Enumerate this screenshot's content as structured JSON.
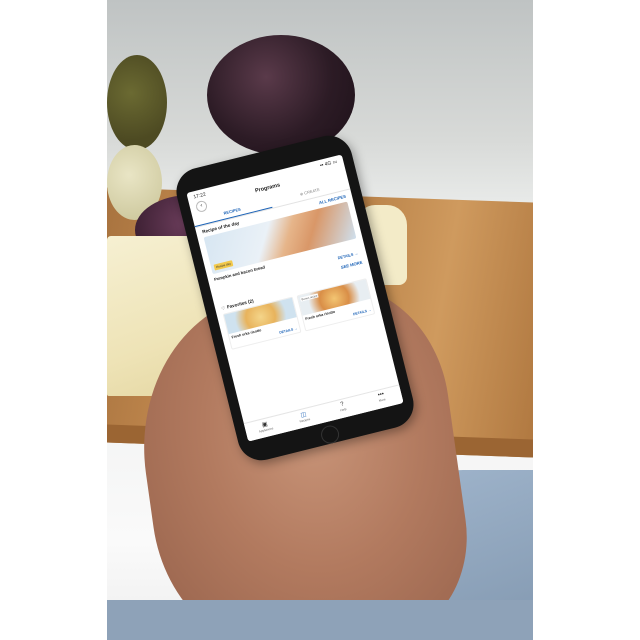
{
  "status_bar": {
    "time": "17:22",
    "signal": "▪▪ 4G ▭"
  },
  "header": {
    "back_icon": "chevron-left-icon",
    "title": "Programs"
  },
  "tabs": [
    {
      "label": "RECIPES",
      "active": true
    },
    {
      "label": "⊕ CREATE",
      "active": false
    }
  ],
  "recipe_of_day": {
    "title": "Recipe of the day",
    "link": "ALL RECIPES",
    "badge": "Recipe day",
    "name": "Pumpkin and bacon bread",
    "details": "DETAILS →"
  },
  "see_more": "SEE MORE",
  "favorites": {
    "title": "Favorites (2)",
    "cards": [
      {
        "badge": "",
        "name": "Fresh orka risotto",
        "details": "DETAILS →"
      },
      {
        "badge": "Bonus recipe",
        "name": "Fresh orka risotto",
        "details": "DETAILS →"
      }
    ]
  },
  "bottom_nav": [
    {
      "icon": "appliance-icon",
      "glyph": "▣",
      "label": "Appliances",
      "active": false
    },
    {
      "icon": "recipes-icon",
      "glyph": "◫",
      "label": "Recipes",
      "active": true
    },
    {
      "icon": "help-icon",
      "glyph": "?",
      "label": "Help",
      "active": false
    },
    {
      "icon": "more-icon",
      "glyph": "•••",
      "label": "More",
      "active": false
    }
  ],
  "colors": {
    "accent": "#1c63b7",
    "badge": "#f2c94c"
  }
}
